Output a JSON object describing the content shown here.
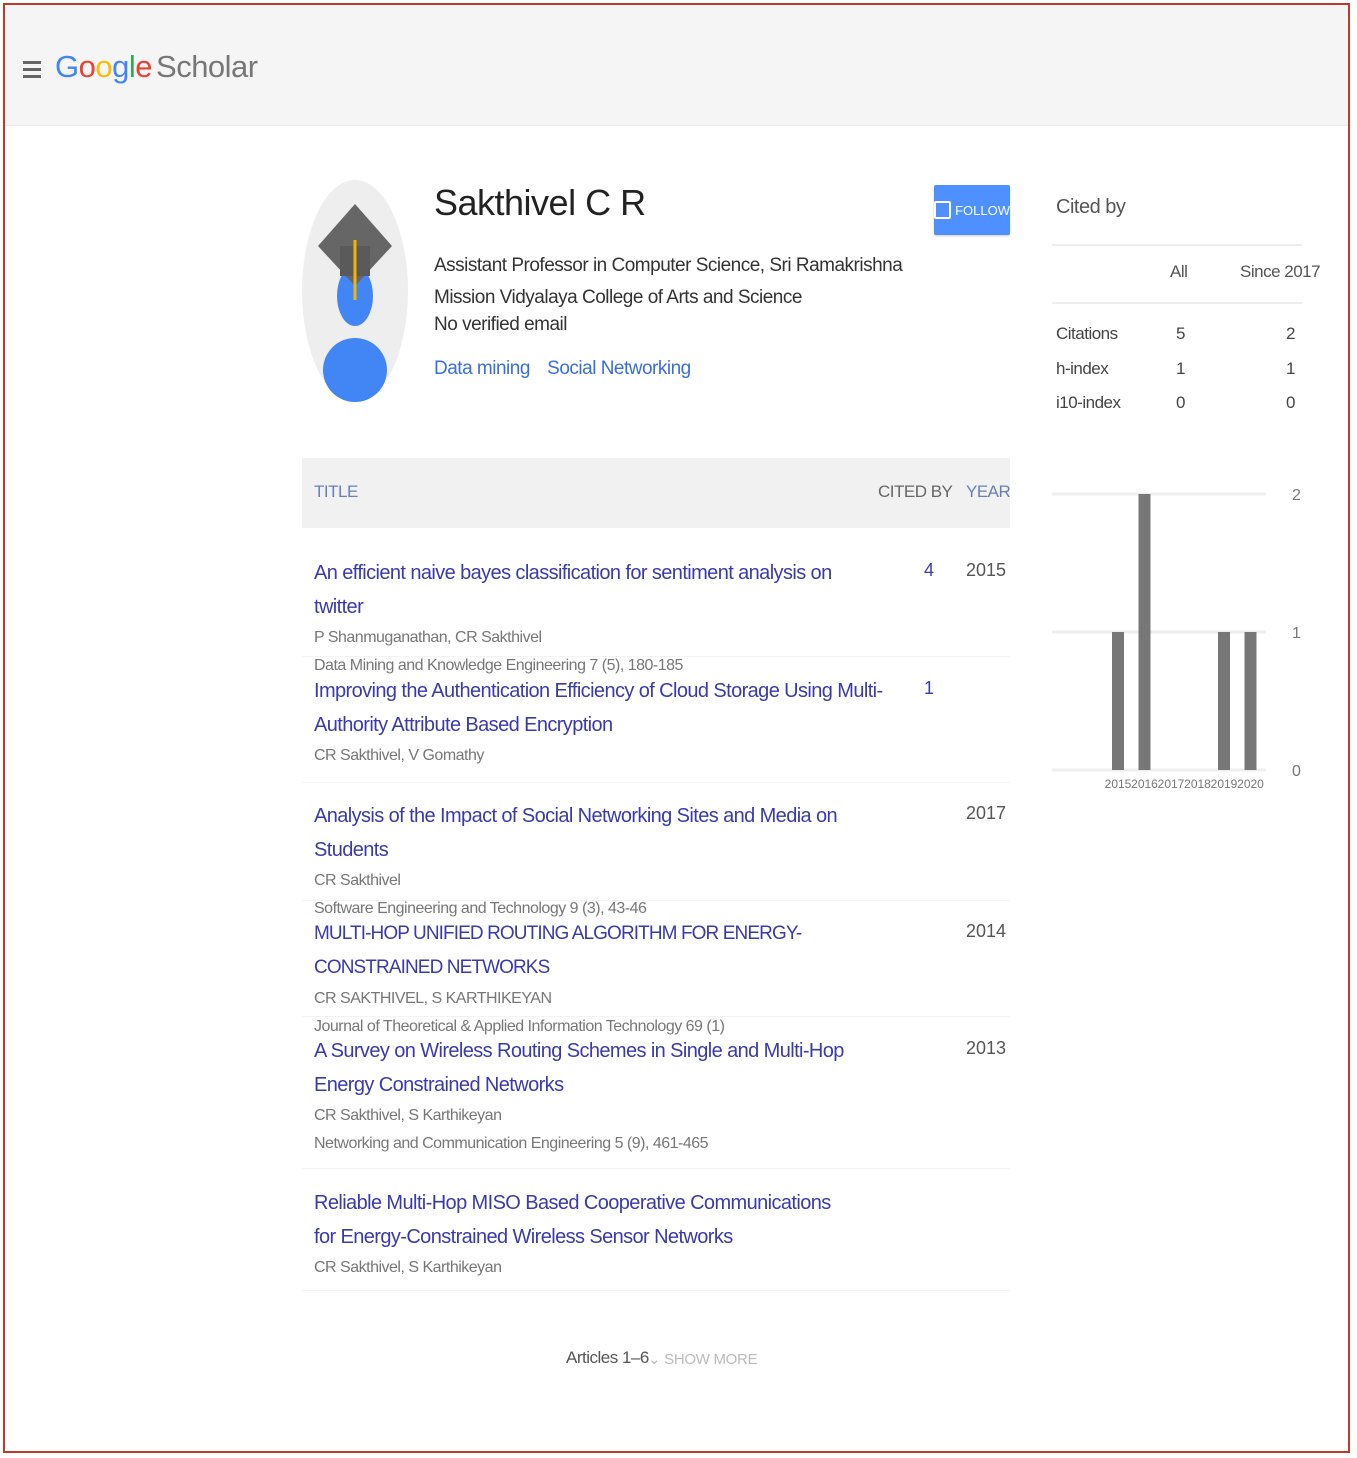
{
  "header": {
    "logo_google": "Google",
    "logo_scholar": "Scholar"
  },
  "profile": {
    "name": "Sakthivel C R",
    "affiliation": "Assistant Professor in Computer Science, Sri Ramakrishna Mission Vidyalaya College of Arts and Science",
    "email": "No verified email",
    "interests": [
      "Data mining",
      "Social Networking"
    ],
    "follow_label": "FOLLOW"
  },
  "table": {
    "col_title": "TITLE",
    "col_cited": "CITED BY",
    "col_year": "YEAR",
    "rows": [
      {
        "title": "An efficient naive bayes classification for sentiment analysis on twitter",
        "authors": "P Shanmuganathan, CR Sakthivel",
        "venue": "Data Mining and Knowledge Engineering 7 (5), 180-185",
        "cited": "4",
        "year": "2015"
      },
      {
        "title": "Improving the Authentication Efficiency of Cloud Storage Using Multi-Authority Attribute Based Encryption",
        "authors": "CR Sakthivel, V Gomathy",
        "venue": "",
        "cited": "1",
        "year": ""
      },
      {
        "title": "Analysis of the Impact of Social Networking Sites and Media on Students",
        "authors": "CR Sakthivel",
        "venue": "Software Engineering and Technology 9 (3), 43-46",
        "cited": "",
        "year": "2017"
      },
      {
        "title": "MULTI-HOP UNIFIED ROUTING ALGORITHM FOR ENERGY-CONSTRAINED NETWORKS",
        "authors": "CR SAKTHIVEL, S KARTHIKEYAN",
        "venue": "Journal of Theoretical & Applied Information Technology 69 (1)",
        "cited": "",
        "year": "2014"
      },
      {
        "title": "A Survey on Wireless Routing Schemes in Single and Multi-Hop Energy Constrained Networks",
        "authors": "CR Sakthivel, S Karthikeyan",
        "venue": "Networking and Communication Engineering 5 (9), 461-465",
        "cited": "",
        "year": "2013"
      },
      {
        "title": "Reliable Multi-Hop MISO Based Cooperative Communications for Energy-Constrained Wireless Sensor Networks",
        "authors": "CR Sakthivel, S Karthikeyan",
        "venue": "",
        "cited": "",
        "year": ""
      }
    ],
    "articles_label": "Articles 1–6",
    "show_more": "SHOW MORE"
  },
  "cited_by": {
    "title": "Cited by",
    "col_all": "All",
    "col_since": "Since 2017",
    "rows": [
      {
        "label": "Citations",
        "all": "5",
        "since": "2"
      },
      {
        "label": "h-index",
        "all": "1",
        "since": "1"
      },
      {
        "label": "i10-index",
        "all": "0",
        "since": "0"
      }
    ]
  },
  "chart_data": {
    "type": "bar",
    "categories": [
      "2015",
      "2016",
      "2017",
      "2018",
      "2019",
      "2020"
    ],
    "values": [
      1,
      2,
      0,
      0,
      1,
      1
    ],
    "ylim": [
      0,
      2
    ],
    "yticks": [
      "0",
      "1",
      "2"
    ],
    "bar_color": "#777777",
    "grid": true
  }
}
